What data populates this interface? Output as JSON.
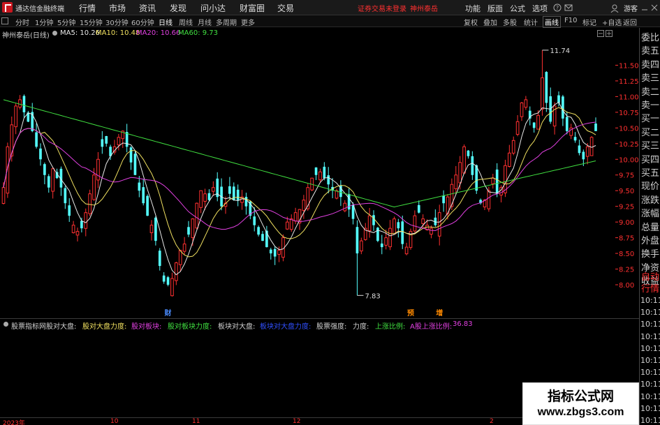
{
  "titlebar": {
    "app_name": "通达信金融终端",
    "menus": [
      "行情",
      "市场",
      "资讯",
      "发现",
      "问小达",
      "财富圈",
      "交易"
    ],
    "warning": "证券交易未登录",
    "stock_name": "神州泰岳",
    "right_menus": [
      "功能",
      "版面",
      "公式",
      "选项"
    ],
    "guest": "游客"
  },
  "periodbar": {
    "periods": [
      "分时",
      "1分钟",
      "5分钟",
      "15分钟",
      "30分钟",
      "60分钟",
      "日线",
      "周线",
      "月线",
      "多周期",
      "更多"
    ],
    "active": "日线",
    "right_tools": [
      "复权",
      "叠加",
      "多股",
      "统计",
      "画线",
      "F10",
      "标记",
      "+自选",
      "返回"
    ]
  },
  "ma_legend": {
    "title": "神州泰岳(日线)",
    "items": [
      {
        "label": "MA5: 10.26",
        "color": "#e8e8e8"
      },
      {
        "label": "MA10: 10.48",
        "color": "#f0e060"
      },
      {
        "label": "MA20: 10.66",
        "color": "#e040e0"
      },
      {
        "label": "MA60: 9.73",
        "color": "#40e040"
      }
    ]
  },
  "right_panel": {
    "items": [
      "委比",
      "卖五",
      "卖四",
      "卖三",
      "卖二",
      "卖一",
      "买一",
      "买二",
      "买三",
      "买四",
      "买五",
      "现价",
      "涨跌",
      "涨幅",
      "总量",
      "外盘",
      "换手",
      "净资",
      "收益"
    ],
    "red_items": [
      "自动",
      "行情"
    ],
    "times": [
      "10:11",
      "10:11",
      "10:11",
      "10:11",
      "10:11",
      "10:11",
      "10:11",
      "10:11",
      "10:11",
      "10:11",
      "10:11"
    ]
  },
  "indicator_bar": {
    "items": [
      {
        "label": "股票指标网",
        "color": "#d0d0d0"
      },
      {
        "label": "股对大盘:",
        "color": "#d0d0d0"
      },
      {
        "label": "股对大盘力度:",
        "color": "#f0e060"
      },
      {
        "label": "股对板块:",
        "color": "#e040e0"
      },
      {
        "label": "股对板块力度:",
        "color": "#40e040"
      },
      {
        "label": "板块对大盘:",
        "color": "#d0d0d0"
      },
      {
        "label": "板块对大盘力度:",
        "color": "#3050ff"
      },
      {
        "label": "股票强度:",
        "color": "#d0d0d0"
      },
      {
        "label": "力度:",
        "color": "#d0d0d0"
      },
      {
        "label": "上涨比例:",
        "color": "#40e040"
      },
      {
        "label": "A股上涨比例:",
        "color": "#e040e0"
      },
      {
        "label": "36.83",
        "color": "#e040e0"
      }
    ]
  },
  "date_axis": [
    "2023年",
    "10",
    "11",
    "12",
    "2"
  ],
  "watermark": {
    "line1": "指标公式网",
    "line2": "www.zbgs3.com"
  },
  "chart_data": {
    "type": "candlestick",
    "title": "神州泰岳(日线)",
    "y_ticks": [
      8.0,
      8.25,
      8.5,
      8.75,
      9.0,
      9.25,
      9.5,
      9.75,
      10.0,
      10.25,
      10.5,
      10.75,
      11.0,
      11.25,
      11.5
    ],
    "ylim": [
      7.7,
      11.85
    ],
    "annotations": [
      {
        "text": "11.74",
        "value": 11.74,
        "bar": 131
      },
      {
        "text": "7.83",
        "value": 7.83,
        "bar": 86
      }
    ],
    "event_markers": [
      {
        "text": "财",
        "bar": 40,
        "color": "#4a8cff"
      },
      {
        "text": "预",
        "bar": 99,
        "color": "#ff8a00"
      },
      {
        "text": "增",
        "bar": 106,
        "color": "#ff8a00"
      }
    ],
    "up_color": "#ff3030",
    "down_color": "#54ffff",
    "ma_colors": {
      "MA5": "#e8e8e8",
      "MA10": "#f0e060",
      "MA20": "#e040e0",
      "MA60": "#40e040"
    },
    "closes": [
      9.55,
      10.2,
      10.55,
      10.85,
      10.95,
      10.75,
      10.6,
      10.45,
      10.2,
      10.0,
      9.75,
      9.55,
      9.85,
      9.7,
      9.55,
      9.3,
      9.1,
      8.95,
      8.85,
      8.9,
      9.15,
      9.45,
      9.75,
      10.0,
      10.2,
      10.25,
      10.05,
      10.2,
      10.35,
      10.45,
      10.2,
      9.95,
      9.75,
      9.5,
      9.3,
      9.1,
      8.95,
      8.7,
      8.3,
      8.05,
      8.0,
      8.1,
      8.35,
      8.55,
      8.65,
      8.8,
      9.05,
      9.3,
      9.5,
      9.45,
      9.35,
      9.55,
      9.4,
      9.25,
      9.3,
      9.45,
      9.35,
      9.35,
      9.4,
      9.25,
      9.1,
      8.95,
      8.8,
      8.7,
      8.6,
      8.5,
      8.45,
      8.55,
      8.75,
      9.0,
      9.05,
      9.15,
      9.2,
      9.35,
      9.55,
      9.7,
      9.75,
      9.8,
      9.7,
      9.6,
      9.5,
      9.5,
      9.4,
      9.3,
      9.2,
      9.05,
      8.5,
      8.7,
      8.9,
      9.1,
      8.95,
      8.7,
      8.6,
      8.75,
      8.9,
      9.05,
      8.9,
      8.65,
      8.6,
      8.85,
      9.1,
      9.15,
      9.05,
      8.95,
      8.9,
      8.95,
      9.15,
      9.3,
      9.4,
      9.6,
      9.75,
      9.95,
      10.2,
      10.05,
      9.75,
      9.5,
      9.3,
      9.35,
      9.5,
      9.7,
      9.45,
      9.55,
      9.9,
      10.1,
      10.3,
      10.6,
      10.9,
      10.95,
      10.65,
      10.5,
      10.7,
      11.3,
      10.9,
      10.6,
      10.85,
      10.9,
      10.65,
      10.45,
      10.5,
      10.3,
      10.1,
      10.0,
      10.2,
      10.35,
      10.45
    ]
  }
}
